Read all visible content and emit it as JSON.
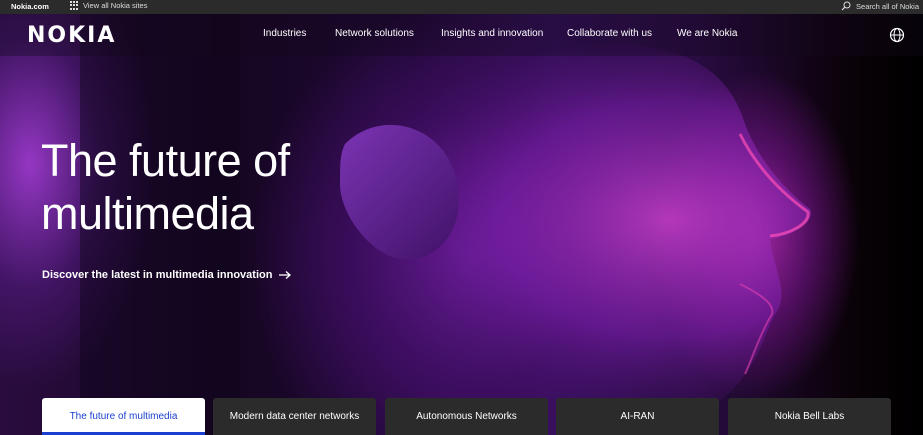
{
  "utility_bar": {
    "site_link": "Nokia.com",
    "all_sites_label": "View all Nokia sites",
    "search_label": "Search all of Nokia"
  },
  "nav": {
    "logo": "NOKIA",
    "items": [
      "Industries",
      "Network solutions",
      "Insights and innovation",
      "Collaborate with us",
      "We are Nokia"
    ]
  },
  "hero": {
    "headline_line1": "The future of",
    "headline_line2": "multimedia",
    "cta": "Discover the latest in multimedia innovation"
  },
  "tabs": [
    {
      "label": "The future of multimedia",
      "active": true
    },
    {
      "label": "Modern data center networks",
      "active": false
    },
    {
      "label": "Autonomous Networks",
      "active": false
    },
    {
      "label": "AI-RAN",
      "active": false
    },
    {
      "label": "Nokia Bell Labs",
      "active": false
    }
  ],
  "colors": {
    "accent": "#1a3fd1",
    "util_bar": "#2b2b2b",
    "tab_bg": "#2b2b2b"
  }
}
